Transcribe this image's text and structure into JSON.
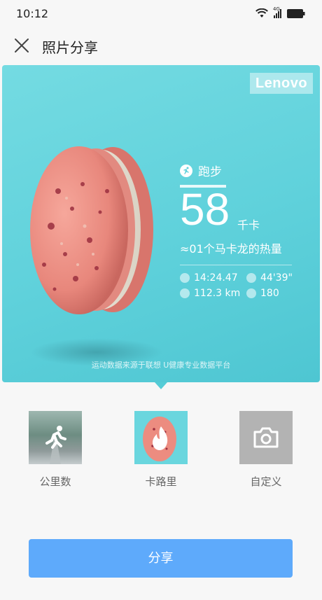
{
  "status": {
    "time": "10:12",
    "signal_text": "4G"
  },
  "header": {
    "title": "照片分享"
  },
  "card": {
    "logo": "Lenovo",
    "activity": "跑步",
    "calories": "58",
    "unit": "千卡",
    "comparison": "≈01个马卡龙的热量",
    "metrics": {
      "duration": "14:24.47",
      "pace": "44'39\"",
      "distance": "112.3 km",
      "heart_rate": "180"
    },
    "footer": "运动数据来源于联想 U健康专业数据平台",
    "colors": {
      "background": "#5fd1db",
      "macaron": "#ee8f84"
    }
  },
  "templates": [
    {
      "label": "公里数",
      "icon": "running-icon"
    },
    {
      "label": "卡路里",
      "icon": "flame-icon"
    },
    {
      "label": "自定义",
      "icon": "camera-icon"
    }
  ],
  "share_button": {
    "label": "分享",
    "color": "#5eaafb"
  }
}
